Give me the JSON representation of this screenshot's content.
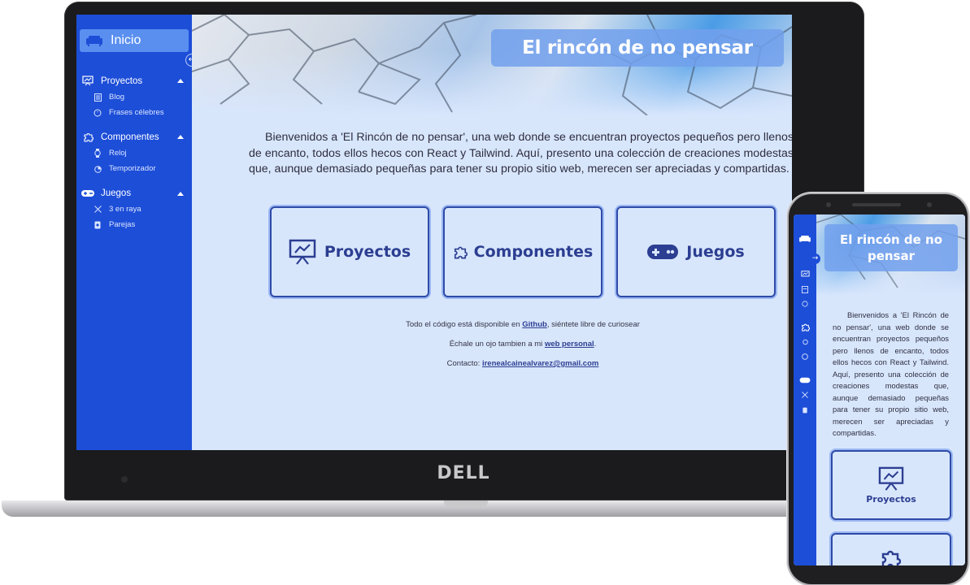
{
  "laptop": {
    "brand": "DELL",
    "sidebar": {
      "home_label": "Inicio",
      "sections": [
        {
          "label": "Proyectos",
          "icon": "presentation-chart-icon",
          "items": [
            {
              "label": "Blog",
              "icon": "document-icon"
            },
            {
              "label": "Frases célebres",
              "icon": "quote-bubble-icon"
            }
          ]
        },
        {
          "label": "Componentes",
          "icon": "puzzle-icon",
          "items": [
            {
              "label": "Reloj",
              "icon": "watch-icon"
            },
            {
              "label": "Temporizador",
              "icon": "timer-icon"
            }
          ]
        },
        {
          "label": "Juegos",
          "icon": "gamepad-icon",
          "items": [
            {
              "label": "3 en raya",
              "icon": "x-mark-icon"
            },
            {
              "label": "Parejas",
              "icon": "cards-icon"
            }
          ]
        }
      ]
    },
    "header": {
      "title": "El rincón de no pensar"
    },
    "intro": "Bienvenidos a 'El Rincón de no pensar', una web donde se encuentran proyectos pequeños pero llenos de encanto, todos ellos hecos con React y Tailwind. Aquí, presento una colección de creaciones modestas que, aunque demasiado pequeñas para tener su propio sitio web, merecen ser apreciadas y compartidas.",
    "cards": [
      {
        "label": "Proyectos",
        "icon": "presentation-chart-icon"
      },
      {
        "label": "Componentes",
        "icon": "puzzle-icon"
      },
      {
        "label": "Juegos",
        "icon": "gamepad-icon"
      }
    ],
    "footer": {
      "line1_prefix": "Todo el código está disponible en ",
      "line1_link": "Github",
      "line1_suffix": ", siéntete libre de curiosear",
      "line2_prefix": "Échale un ojo tambien a mi ",
      "line2_link": "web personal",
      "line2_suffix": ".",
      "line3_prefix": "Contacto: ",
      "line3_link": "irenealcainealvarez@gmail.com"
    }
  },
  "phone": {
    "title": "El rincón de no pensar",
    "intro": "Bienvenidos a 'El Rincón de no pensar', una web donde se encuentran proyectos pequeños pero llenos de encanto, todos ellos hecos con React y Tailwind. Aquí, presento una colección de creaciones modestas que, aunque demasiado pequeñas para tener su propio sitio web, merecen ser apreciadas y compartidas.",
    "cards": [
      {
        "label": "Proyectos",
        "icon": "presentation-chart-icon"
      },
      {
        "label": "",
        "icon": "puzzle-icon"
      }
    ]
  },
  "colors": {
    "sidebar": "#1d4ed8",
    "page_bg": "#d8e6fc",
    "accent_text": "#2c3e91",
    "title_box": "#72a0ec"
  }
}
